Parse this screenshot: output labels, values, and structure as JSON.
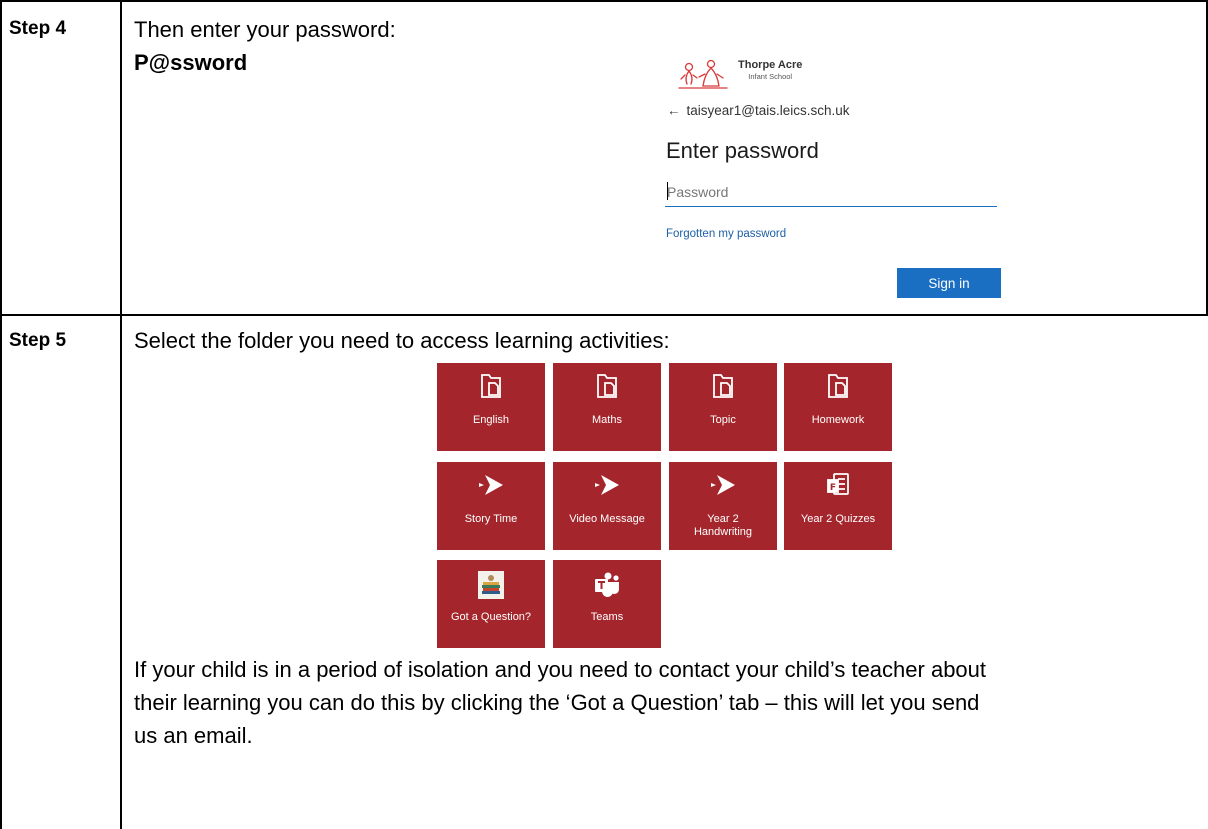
{
  "step4": {
    "label": "Step 4",
    "instruction": "Then enter your password:",
    "password_value": "P@ssword",
    "signin": {
      "school_name": "Thorpe Acre",
      "school_subtitle": "Infant School",
      "back_arrow": "←",
      "email": "taisyear1@tais.leics.sch.uk",
      "title": "Enter password",
      "password_placeholder": "Password",
      "forgot_link": "Forgotten my password",
      "sign_in_button": "Sign in",
      "accent_color": "#1a6fc3"
    }
  },
  "step5": {
    "label": "Step 5",
    "instruction": "Select the folder you need to access learning activities:",
    "tile_color": "#a4262c",
    "tiles": [
      {
        "label": "English",
        "icon": "folder-icon"
      },
      {
        "label": "Maths",
        "icon": "folder-icon"
      },
      {
        "label": "Topic",
        "icon": "folder-icon"
      },
      {
        "label": "Homework",
        "icon": "folder-icon"
      },
      {
        "label": "Story Time",
        "icon": "stream-play-icon"
      },
      {
        "label": "Video Message",
        "icon": "stream-play-icon"
      },
      {
        "label": "Year 2 Handwriting",
        "icon": "stream-play-icon"
      },
      {
        "label": "Year 2 Quizzes",
        "icon": "forms-icon"
      },
      {
        "label": "Got a Question?",
        "icon": "question-image-icon"
      },
      {
        "label": "Teams",
        "icon": "teams-icon"
      }
    ],
    "note_line1": "If your child is in a period of isolation and you need to contact your child’s teacher about",
    "note_line2": "their learning you can do this by clicking the ‘Got a Question’ tab – this will let you send",
    "note_line3": "us an email."
  }
}
